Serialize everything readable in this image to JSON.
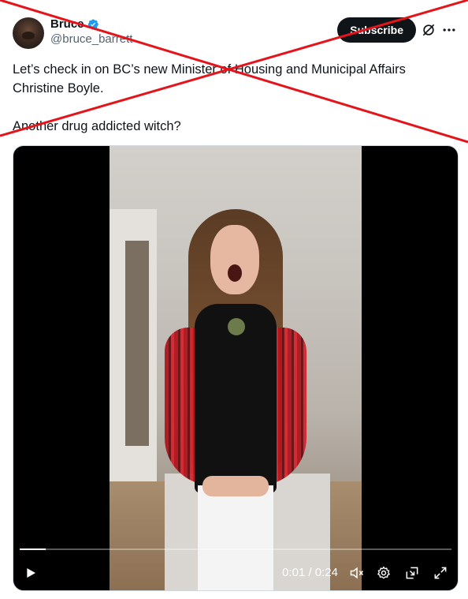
{
  "author": {
    "display_name": "Bruce",
    "handle": "@bruce_barrett",
    "verified_icon": "verified-badge-icon",
    "avatar_icon": "avatar"
  },
  "actions": {
    "subscribe_label": "Subscribe",
    "grok_icon": "grok-icon",
    "more_icon": "more-icon"
  },
  "tweet": {
    "line1": "Let’s check in on BC’s new Minister of Housing and Municipal Affairs",
    "line2": "Christine Boyle.",
    "line3": "Another drug addicted witch?"
  },
  "video": {
    "current_time": "0:01",
    "duration": "0:24",
    "time_display": "0:01 / 0:24",
    "progress_fraction": 0.06,
    "controls": [
      "play-icon",
      "mute-icon",
      "settings-icon",
      "picture-in-picture-icon",
      "fullscreen-icon"
    ]
  },
  "colors": {
    "text": "#0f1419",
    "secondary_text": "#536471",
    "verified": "#1d9bf0",
    "subscribe_bg": "#0f1419",
    "overlay_cross": "#e5141b"
  }
}
